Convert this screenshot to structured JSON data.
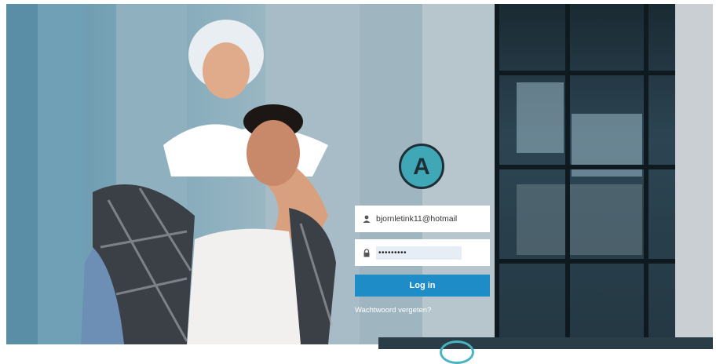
{
  "login": {
    "username_value": "bjornletink11@hotmail",
    "password_value": "•••••••••",
    "button_label": "Log in",
    "forgot_label": "Wachtwoord vergeten?",
    "logo_letter": "A"
  },
  "icons": {
    "user": "user-icon",
    "lock": "lock-icon"
  },
  "colors": {
    "accent": "#1e8dc7",
    "logo": "#3fa7b6"
  }
}
